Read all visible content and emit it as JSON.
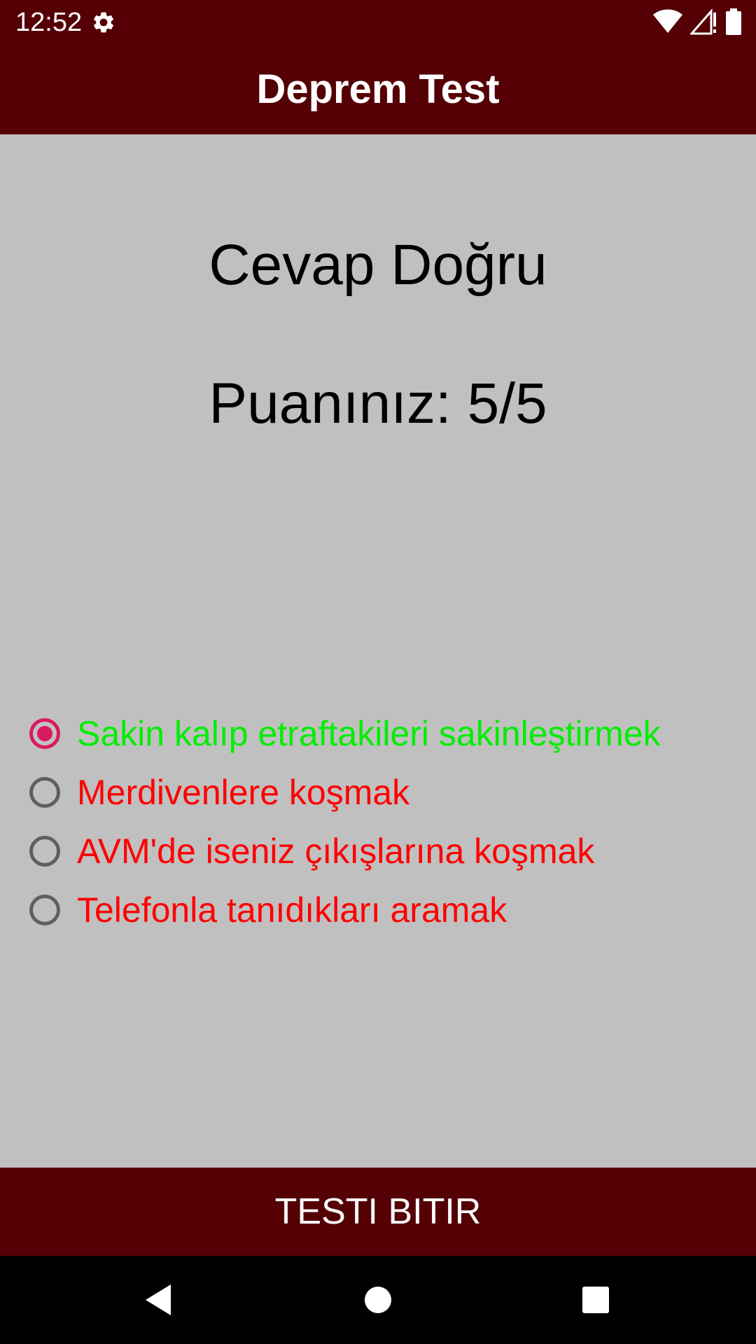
{
  "status_bar": {
    "time": "12:52",
    "icons": [
      "gear-icon",
      "wifi-icon",
      "cell-signal-icon",
      "battery-icon"
    ]
  },
  "app_bar": {
    "title": "Deprem Test"
  },
  "result": {
    "answer_status": "Cevap Doğru",
    "score": "Puanınız: 5/5"
  },
  "options": [
    {
      "label": "Sakin kalıp etraftakileri sakinleştirmek",
      "selected": true,
      "color": "#00ee00"
    },
    {
      "label": "Merdivenlere koşmak",
      "selected": false,
      "color": "#ff0000"
    },
    {
      "label": "AVM'de iseniz çıkışlarına koşmak",
      "selected": false,
      "color": "#ff0000"
    },
    {
      "label": "Telefonla tanıdıkları aramak",
      "selected": false,
      "color": "#ff0000"
    }
  ],
  "finish_button": {
    "label": "TESTI BITIR"
  },
  "nav_bar": {
    "icons": [
      "back-icon",
      "home-icon",
      "recents-icon"
    ]
  },
  "colors": {
    "primary_dark": "#540005",
    "background": "#c0c0c0",
    "radio_accent": "#d81b60",
    "correct": "#00ee00",
    "incorrect": "#ff0000"
  }
}
